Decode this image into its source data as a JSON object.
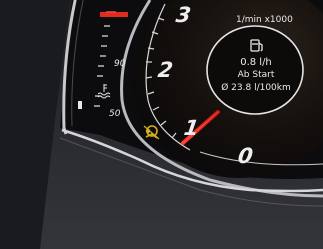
{
  "rpm_gauge": {
    "unit_label": "1/min x1000",
    "visible_numbers": [
      "3",
      "2",
      "1",
      "0"
    ],
    "needle_color": "#e8221c"
  },
  "info_center": {
    "icon": "fuel-pump-icon",
    "current_consumption": "0.8 l/h",
    "since_label": "Ab Start",
    "average_consumption": "Ø 23.8 l/100km"
  },
  "temp_gauge": {
    "tick_labels": [
      "90",
      "50"
    ],
    "icon": "coolant-temperature-icon",
    "warning_color": "#e02a22"
  },
  "warning_lights": [
    {
      "icon": "airbag-off-icon",
      "color": "#d6b11a"
    }
  ]
}
